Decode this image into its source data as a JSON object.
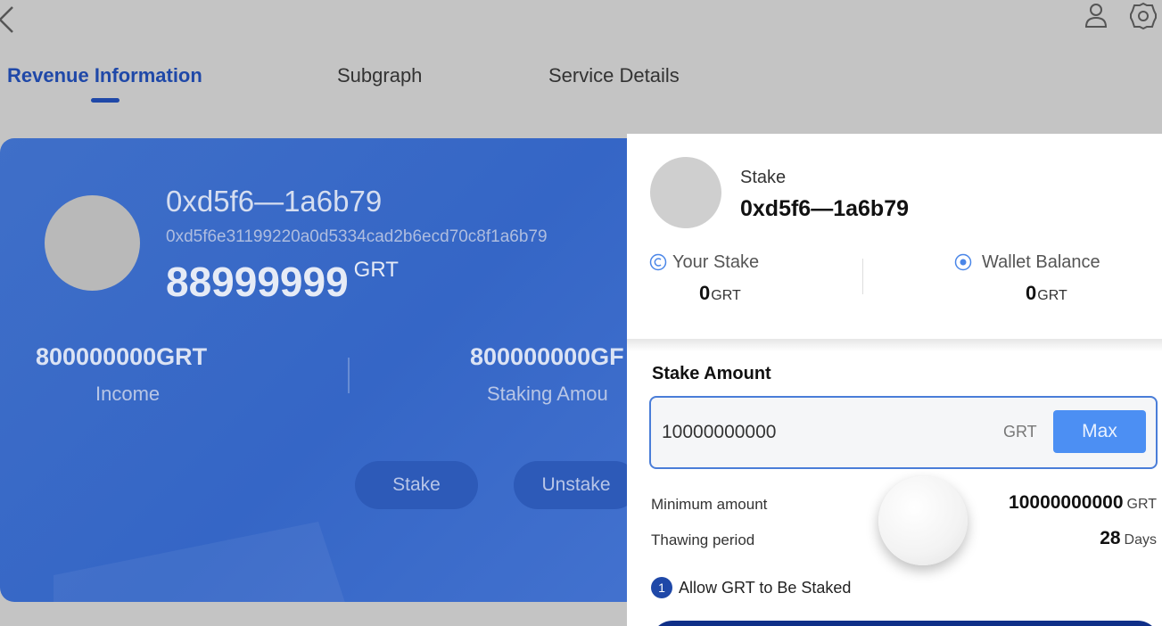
{
  "header": {
    "icons": {
      "back": "chevron-left-icon",
      "user": "user-icon",
      "settings": "gear-icon"
    }
  },
  "tabs": [
    {
      "label": "Revenue Information",
      "active": true
    },
    {
      "label": "Subgraph",
      "active": false
    },
    {
      "label": "Service Details",
      "active": false
    }
  ],
  "indexer_card": {
    "name": "0xd5f6—1a6b79",
    "address": "0xd5f6e31199220a0d5334cad2b6ecd70c8f1a6b79",
    "balance": "88999999",
    "balance_unit": "GRT",
    "income_value": "800000000GRT",
    "income_label": "Income",
    "staking_value": "800000000GF",
    "staking_label": "Staking Amou",
    "stake_button": "Stake",
    "unstake_button": "Unstake"
  },
  "stake_panel": {
    "label": "Stake",
    "name": "0xd5f6—1a6b79",
    "your_stake_label": "Your  Stake",
    "your_stake_value": "0",
    "your_stake_unit": "GRT",
    "wallet_balance_label": "Wallet Balance",
    "wallet_balance_value": "0",
    "wallet_balance_unit": "GRT",
    "amount_title": "Stake Amount",
    "amount_value": "10000000000",
    "amount_unit": "GRT",
    "max_button": "Max",
    "minimum_label": "Minimum amount",
    "minimum_value": "10000000000",
    "minimum_unit": "GRT",
    "thawing_label": "Thawing period",
    "thawing_value": "28",
    "thawing_unit": "Days",
    "step_number": "1",
    "step_text": "Allow GRT to Be Staked"
  },
  "colors": {
    "accent": "#1f48a8",
    "card_blue": "#3566c6",
    "max_button": "#4c8ff3",
    "overlay_gray": "#c4c4c4"
  }
}
